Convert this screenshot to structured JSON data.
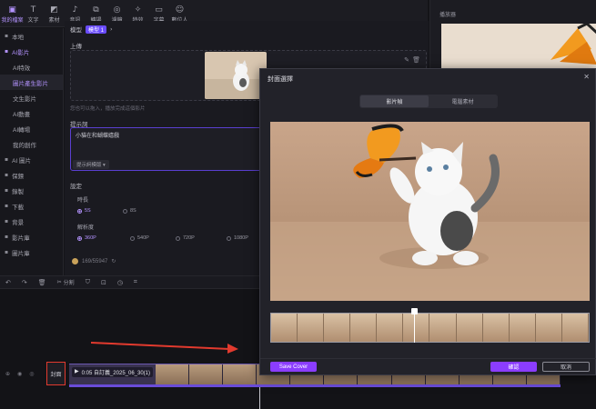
{
  "toolbar": {
    "items": [
      {
        "label": "我的檔案",
        "icon": "folder-icon"
      },
      {
        "label": "文字",
        "icon": "text-icon"
      },
      {
        "label": "素材",
        "icon": "sticker-icon"
      },
      {
        "label": "音訊",
        "icon": "music-icon"
      },
      {
        "label": "轉場",
        "icon": "transition-icon"
      },
      {
        "label": "濾鏡",
        "icon": "filter-icon"
      },
      {
        "label": "特效",
        "icon": "effects-icon"
      },
      {
        "label": "字幕",
        "icon": "subtitle-icon"
      },
      {
        "label": "數位人",
        "icon": "avatar-icon"
      }
    ]
  },
  "sidebar": {
    "items": [
      {
        "label": "本地",
        "sub": false
      },
      {
        "label": "AI影片",
        "sub": false
      },
      {
        "label": "AI特效",
        "sub": true
      },
      {
        "label": "圖片產生影片",
        "sub": true
      },
      {
        "label": "文生影片",
        "sub": true
      },
      {
        "label": "AI動畫",
        "sub": true
      },
      {
        "label": "AI轉場",
        "sub": true
      },
      {
        "label": "我的創作",
        "sub": true
      },
      {
        "label": "AI 圖片",
        "sub": false
      },
      {
        "label": "保鏢",
        "sub": false
      },
      {
        "label": "錄製",
        "sub": false
      },
      {
        "label": "下載",
        "sub": false
      },
      {
        "label": "背景",
        "sub": false
      },
      {
        "label": "影片庫",
        "sub": false
      },
      {
        "label": "圖片庫",
        "sub": false
      }
    ]
  },
  "main": {
    "model_label": "模型",
    "model_value": "模型 1",
    "upload_title": "上傳",
    "upload_hint": "您也可以拖入，播放完成這個影片",
    "prompt_title": "提示詞",
    "prompt_text": "小貓在和蝴蝶嬉戲",
    "prompt_template": "提示詞模版",
    "settings_title": "設定",
    "duration_label": "時長",
    "duration_options": [
      "5S",
      "8S"
    ],
    "resolution_label": "解析度",
    "resolution_options": [
      "360P",
      "540P",
      "720P",
      "1080P"
    ],
    "credits": "169/55947"
  },
  "preview": {
    "title": "播放器"
  },
  "timeline": {
    "split_label": "分割",
    "cover_label": "封面",
    "clip_label": "0:05 自訂義_2025_06_30(1)"
  },
  "modal": {
    "title": "封面選擇",
    "tabs": [
      "影片幀",
      "電腦素材"
    ],
    "save_cover": "Save Cover",
    "confirm": "確認",
    "cancel": "取消"
  },
  "colors": {
    "accent": "#8b3dff",
    "highlight_box": "#e23a2e",
    "arrow": "#e23a2e"
  }
}
